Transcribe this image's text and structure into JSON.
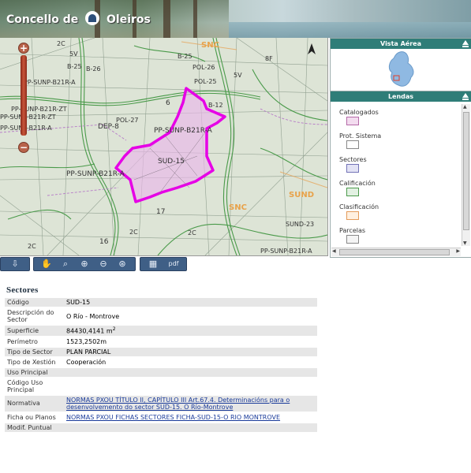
{
  "header": {
    "title_part1": "Concello de",
    "title_part2": "Oleiros"
  },
  "map": {
    "labels": [
      "SNC",
      "2C",
      "5V",
      "B-25",
      "POL-26",
      "POL-25",
      "PP-SUNP-B21R-A",
      "PP-SUNP-B21R-ZT",
      "PP-SUNP-B21R-ZT",
      "PP-SUNP-B21R-A",
      "POL-27",
      "DEP-8",
      "PP-SUNP-B21R-A",
      "PP-SUNP-B21R-A",
      "SUD-15",
      "B-25",
      "B-12",
      "B-26",
      "SUND",
      "SUND-23",
      "PP-SUNP-B21R-A",
      "6",
      "17",
      "16",
      "2C",
      "2C",
      "8F",
      "5V",
      "SNC",
      "2C"
    ],
    "zoom_in": "+",
    "zoom_out": "−",
    "north": "N"
  },
  "aerial": {
    "title": "Vista Aérea"
  },
  "legend": {
    "title": "Lendas",
    "items": [
      {
        "label": "Catalogados",
        "swatch": "#f3dcef",
        "border": "#b56aa8"
      },
      {
        "label": "Prot. Sistema",
        "swatch": "#ffffff",
        "border": "#888888"
      },
      {
        "label": "Sectores",
        "swatch": "#e3e3f5",
        "border": "#7373b7"
      },
      {
        "label": "Calificación",
        "swatch": "#e2f1e2",
        "border": "#4c9a4c"
      },
      {
        "label": "Clasificación",
        "swatch": "#fff0e0",
        "border": "#e49b5a"
      },
      {
        "label": "Parcelas",
        "swatch": "#f4f4f4",
        "border": "#888888"
      }
    ]
  },
  "toolbar": {
    "buttons": [
      "download-icon",
      "pan-icon",
      "zoom-window-icon",
      "zoom-in-icon",
      "zoom-out-icon",
      "zoom-extent-icon",
      "print-icon",
      "pdf-icon"
    ],
    "pdf_label": "pdf"
  },
  "sector": {
    "title": "Sectores",
    "rows": [
      {
        "key": "Código",
        "value": "SUD-15"
      },
      {
        "key": "Descripción do Sector",
        "value": "O Río - Montrove"
      },
      {
        "key": "Superficie",
        "value": "84430,4141 m",
        "sup": "2"
      },
      {
        "key": "Perímetro",
        "value": "1523,2502m"
      },
      {
        "key": "Tipo de Sector",
        "value": "PLAN PARCIAL"
      },
      {
        "key": "Tipo de Xestión",
        "value": "Cooperación"
      },
      {
        "key": "Uso Principal",
        "value": ""
      },
      {
        "key": "Código Uso Principal",
        "value": ""
      },
      {
        "key": "Normativa",
        "value": "NORMAS PXOU TÍTULO II, CAPÍTULO III Art.67.4. Determinacións para o desenvolvemento do sector SUD-15. O Río-Montrove",
        "link": true
      },
      {
        "key": "Ficha ou Planos",
        "value": "NORMAS PXOU FICHAS SECTORES FICHA-SUD-15-O RIO MONTROVE",
        "link": true
      },
      {
        "key": "Modif. Puntual",
        "value": ""
      }
    ]
  }
}
